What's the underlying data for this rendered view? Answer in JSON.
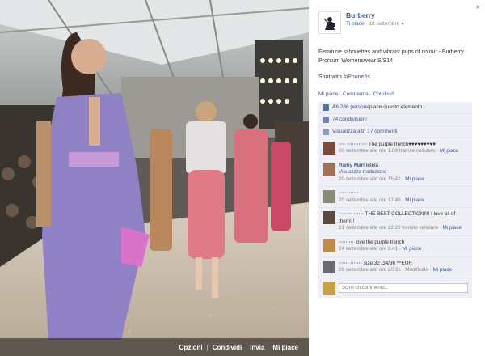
{
  "photo": {
    "actions": [
      "Opzioni",
      "Condividi",
      "Invia",
      "Mi piace"
    ]
  },
  "panel": {
    "close_glyph": "×",
    "page_name": "Burberry",
    "meta_like": "Ti piace",
    "meta_date": "18 settembre",
    "caption": "Feminine silhouettes and vibrant pops of colour - Burberry Prorsum Womenswear S/S14",
    "shot_prefix": "Shot with ",
    "shot_tag": "#iPhone5s",
    "actions": {
      "like": "Mi piace",
      "comment": "Commenta",
      "share": "Condividi"
    },
    "likes_prefix": "A ",
    "likes_count": "6.286 persone",
    "likes_suffix": " piace questo elemento.",
    "shares": "74 condivisioni",
    "view_more": "Visualizza altri 17 commenti",
    "comments": [
      {
        "author": "···· ············",
        "text": " The purple trench♥♥♥♥♥♥♥♥♥",
        "date": "20 settembre alle ore 1.08 tramite cellulare",
        "like": "Mi piace",
        "avatar": "#7a4a3a"
      },
      {
        "author": "Ramy Marí",
        "text": " tetela",
        "extra": "Visualizza traduzione",
        "date": "20 settembre alle ore 15.42",
        "like": "Mi piace",
        "avatar": "#a07058"
      },
      {
        "author": "····· ······",
        "text": "",
        "date": "20 settembre alle ore 17.46",
        "like": "Mi piace",
        "avatar": "#8a8a7a"
      },
      {
        "author": "········ ······",
        "text": " THE BEST COLLECTION!!!! I love all of them!!!",
        "date": "21 settembre alle ore 22.29 tramite cellulare",
        "like": "Mi piace",
        "avatar": "#5a4a40"
      },
      {
        "author": "·········",
        "text": " love the purple trench",
        "date": "24 settembre alle ore 3.41",
        "like": "Mi piace",
        "avatar": "#c08a4a"
      },
      {
        "author": "······ ·······",
        "text": " size 32 /34/36 ^^EUR",
        "date": "25 settembre alle ore 20.31",
        "modified": "Modificato",
        "like": "Mi piace",
        "avatar": "#6a6a70"
      }
    ],
    "write_placeholder": "Scrivi un commento...",
    "sep_dot": " · "
  }
}
